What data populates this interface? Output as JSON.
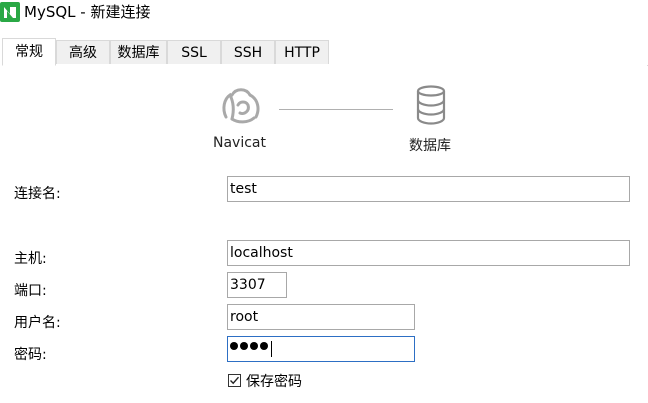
{
  "window": {
    "title": "MySQL - 新建连接",
    "icon": "navicat-app-icon"
  },
  "tabs": [
    {
      "label": "常规",
      "active": true
    },
    {
      "label": "高级",
      "active": false
    },
    {
      "label": "数据库",
      "active": false
    },
    {
      "label": "SSL",
      "active": false
    },
    {
      "label": "SSH",
      "active": false
    },
    {
      "label": "HTTP",
      "active": false
    }
  ],
  "graphic": {
    "left_caption": "Navicat",
    "right_caption": "数据库",
    "left_icon": "navicat-logo-icon",
    "right_icon": "database-icon"
  },
  "form": {
    "connection_name": {
      "label": "连接名:",
      "value": "test"
    },
    "host": {
      "label": "主机:",
      "value": "localhost"
    },
    "port": {
      "label": "端口:",
      "value": "3307"
    },
    "username": {
      "label": "用户名:",
      "value": "root"
    },
    "password": {
      "label": "密码:",
      "masked_length": 4
    },
    "save_password": {
      "label": "保存密码",
      "checked": true
    }
  },
  "colors": {
    "app_icon": "#2aa845",
    "focus_border": "#2d6fc4"
  }
}
